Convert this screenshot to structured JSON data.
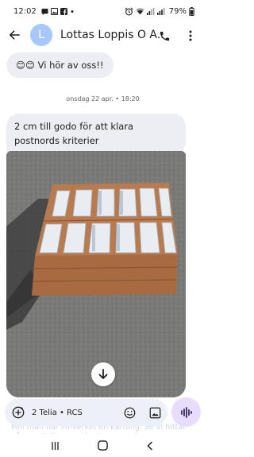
{
  "status_bar": {
    "time": "12:02",
    "battery": "79%",
    "notification_icons": [
      "messages-icon",
      "gallery-icon",
      "facebook-icon",
      "dot-icon"
    ]
  },
  "app_bar": {
    "avatar_letter": "L",
    "title": "Lottas Loppis O A...",
    "avatar_color": "#a8c7fa"
  },
  "messages": {
    "top_bubble": "😊😊 Vi hör av oss!!",
    "date_separator": "onsdag 22 apr. • 18:20",
    "text_bubble": "2 cm till godo för att klara postnords kriterier"
  },
  "composer": {
    "sim_label": "2 Telia • RCS",
    "ghost_text": "Min man har limverket en kartong. Se vi hittat någon att lägga en kartong som kan"
  },
  "colors": {
    "bubble": "#eceef4",
    "accent": "#e9ddff",
    "tape": "#b97a4e"
  }
}
